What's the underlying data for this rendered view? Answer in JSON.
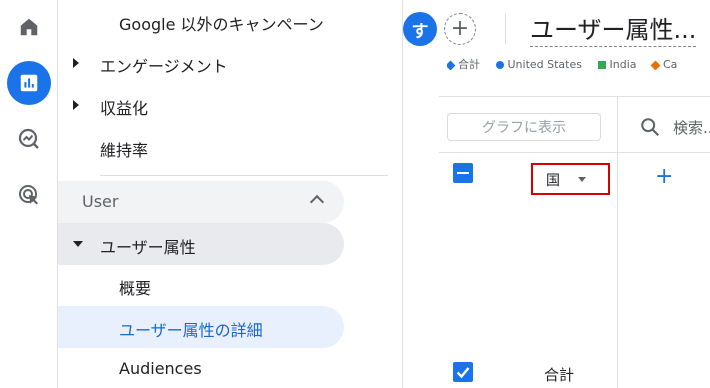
{
  "rail": {
    "items": [
      {
        "icon": "home-icon",
        "active": false
      },
      {
        "icon": "reports-icon",
        "active": true
      },
      {
        "icon": "explore-icon",
        "active": false
      },
      {
        "icon": "advertising-icon",
        "active": false
      }
    ]
  },
  "nav": {
    "items": [
      {
        "label": "Google 以外のキャンペーン"
      },
      {
        "label": "エンゲージメント"
      },
      {
        "label": "収益化"
      },
      {
        "label": "維持率"
      }
    ],
    "user_section": {
      "label": "User"
    },
    "user_items": [
      {
        "label": "ユーザー属性"
      },
      {
        "label": "概要"
      },
      {
        "label": "ユーザー属性の詳細"
      },
      {
        "label": "Audiences"
      }
    ]
  },
  "header": {
    "avatar_letter": "す",
    "add_comparison": "+",
    "title": "ユーザー属性..."
  },
  "chart_legend": {
    "items": [
      {
        "label": "合計",
        "color": "#1a73e8"
      },
      {
        "label": "United States",
        "color": "#1a73e8"
      },
      {
        "label": "India",
        "color": "#34a853"
      },
      {
        "label": "Ca",
        "color": "#e8710a"
      }
    ]
  },
  "table": {
    "plot_button": "グラフに表示",
    "search_placeholder": "検索...",
    "dimension_label": "国",
    "add_dimension": "+",
    "total_row_label": "合計"
  },
  "colors": {
    "accent": "#1a73e8",
    "highlight_box": "#d50000"
  }
}
